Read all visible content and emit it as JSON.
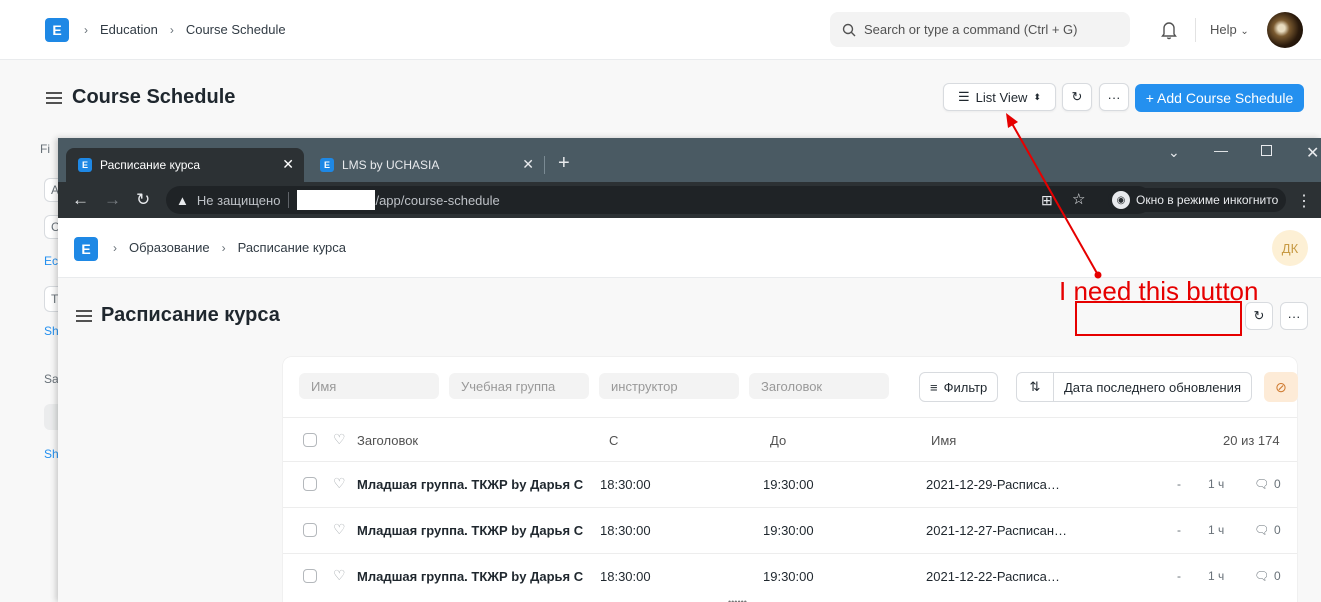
{
  "bg_app": {
    "logo_letter": "E",
    "breadcrumbs": [
      "Education",
      "Course Schedule"
    ],
    "search_placeholder": "Search or type a command (Ctrl + G)",
    "help_label": "Help",
    "page_title": "Course Schedule",
    "list_view_label": "List View",
    "add_button_label": "+ Add Course Schedule",
    "sidebar_fragments": [
      "Fi",
      "A",
      "C",
      "Ec",
      "T",
      "Sh",
      "Sa",
      "Sh"
    ]
  },
  "browser": {
    "tabs": [
      {
        "title": "Расписание курса",
        "active": true
      },
      {
        "title": "LMS by UCHASIA",
        "active": false
      }
    ],
    "security_label": "Не защищено",
    "url_path": "/app/course-schedule",
    "incognito_label": "Окно в режиме инкогнито"
  },
  "inner_app": {
    "logo_letter": "E",
    "breadcrumbs": [
      "Образование",
      "Расписание курса"
    ],
    "avatar_initials": "ДК",
    "page_title": "Расписание курса",
    "filters": [
      "Имя",
      "Учебная группа",
      "инструктор",
      "Заголовок"
    ],
    "filter_button": "Фильтр",
    "sort_label": "Дата последнего обновления",
    "columns": [
      "Заголовок",
      "С",
      "До",
      "Имя"
    ],
    "count": "20 из 174",
    "rows": [
      {
        "title": "Младшая группа. ТКЖР by Дарья С",
        "from": "18:30:00",
        "to": "19:30:00",
        "name": "2021-12-29-Расписа…",
        "dash": "-",
        "age": "1 ч",
        "comments": "0"
      },
      {
        "title": "Младшая группа. ТКЖР by Дарья С",
        "from": "18:30:00",
        "to": "19:30:00",
        "name": "2021-12-27-Расписан…",
        "dash": "-",
        "age": "1 ч",
        "comments": "0"
      },
      {
        "title": "Младшая группа. ТКЖР by Дарья С",
        "from": "18:30:00",
        "to": "19:30:00",
        "name": "2021-12-22-Расписа…",
        "dash": "-",
        "age": "1 ч",
        "comments": "0"
      }
    ]
  },
  "annotation": {
    "text": "I need this button",
    "color": "#e60000"
  },
  "colors": {
    "primary": "#2490ef",
    "logo": "#1e88e5",
    "browser_frame": "#4a5a63"
  }
}
